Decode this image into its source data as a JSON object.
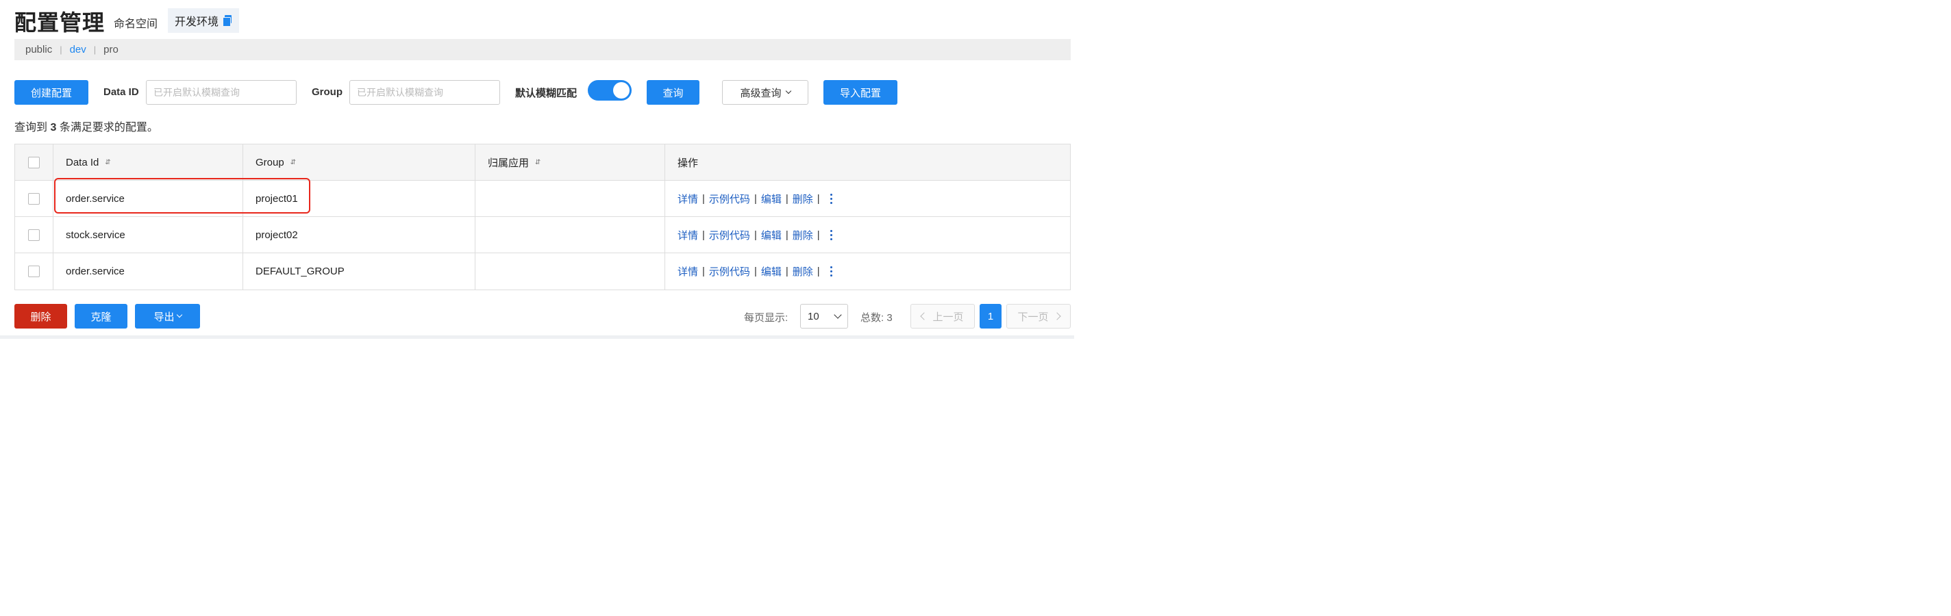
{
  "header": {
    "title": "配置管理",
    "namespace_label": "命名空间",
    "env_label": "开发环境"
  },
  "namespaces": [
    "public",
    "dev",
    "pro"
  ],
  "active_namespace": "dev",
  "toolbar": {
    "create_label": "创建配置",
    "data_id_label": "Data ID",
    "data_id_placeholder": "已开启默认模糊查询",
    "group_label": "Group",
    "group_placeholder": "已开启默认模糊查询",
    "fuzzy_label": "默认模糊匹配",
    "fuzzy_enabled": true,
    "query_label": "查询",
    "advanced_label": "高级查询",
    "import_label": "导入配置"
  },
  "result": {
    "prefix": "查询到",
    "count": "3",
    "suffix": "条满足要求的配置。"
  },
  "table": {
    "headers": [
      "Data Id",
      "Group",
      "归属应用",
      "操作"
    ],
    "rows": [
      {
        "data_id": "order.service",
        "group": "project01",
        "app": ""
      },
      {
        "data_id": "stock.service",
        "group": "project02",
        "app": ""
      },
      {
        "data_id": "order.service",
        "group": "DEFAULT_GROUP",
        "app": ""
      }
    ],
    "actions": {
      "detail": "详情",
      "sample": "示例代码",
      "edit": "编辑",
      "delete": "删除"
    }
  },
  "footer": {
    "delete_label": "删除",
    "clone_label": "克隆",
    "export_label": "导出",
    "page_size_label": "每页显示:",
    "page_size": "10",
    "total_label": "总数:",
    "total": "3",
    "prev_label": "上一页",
    "current_page": "1",
    "next_label": "下一页"
  },
  "colors": {
    "primary": "#1e87f0",
    "danger": "#cc2a17",
    "highlight_border": "#e8271c",
    "link": "#1e5fc2"
  }
}
